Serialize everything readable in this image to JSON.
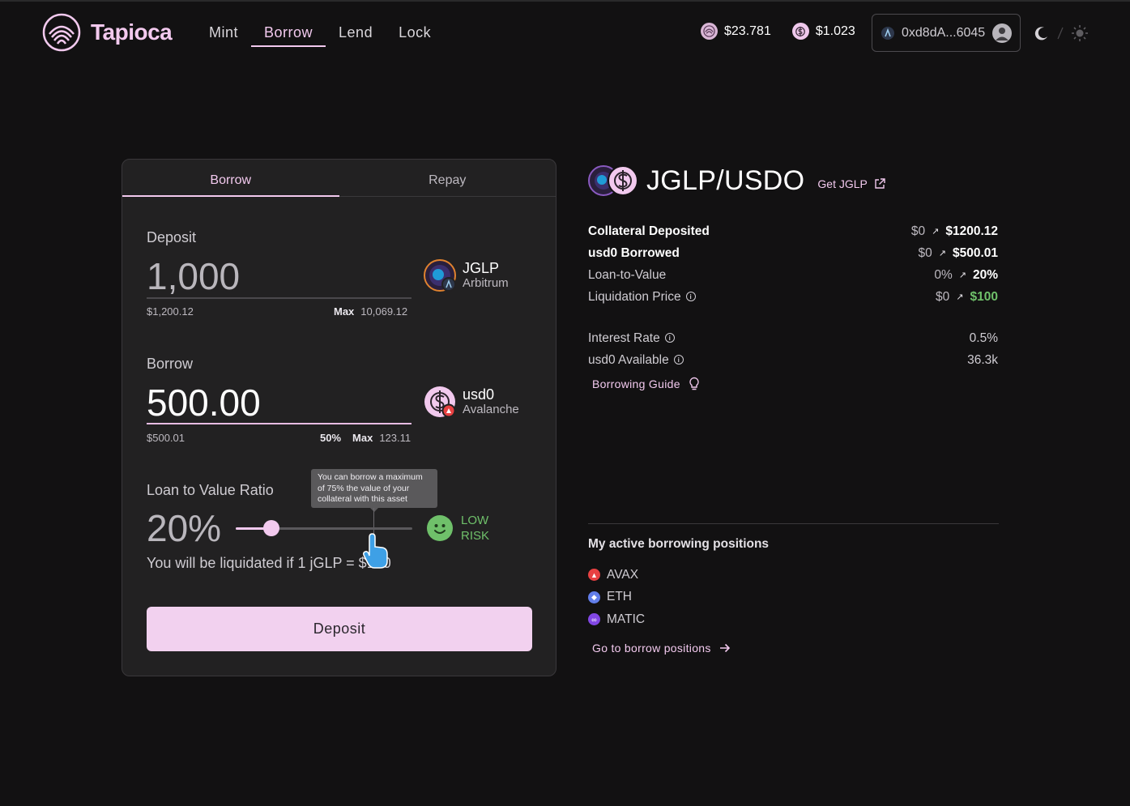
{
  "app": {
    "name": "Tapioca"
  },
  "nav": {
    "items": [
      "Mint",
      "Borrow",
      "Lend",
      "Lock"
    ],
    "active": "Borrow"
  },
  "header": {
    "prices": [
      {
        "icon": "tap-coin-icon",
        "value": "$23.781"
      },
      {
        "icon": "usdo-coin-icon",
        "value": "$1.023"
      }
    ],
    "wallet": {
      "address": "0xd8dA...6045"
    }
  },
  "card": {
    "tabs": [
      "Borrow",
      "Repay"
    ],
    "active_tab": "Borrow",
    "deposit": {
      "label": "Deposit",
      "value": "1,000",
      "usd": "$1,200.12",
      "max_label": "Max",
      "max_value": "10,069.12",
      "asset": "JGLP",
      "chain": "Arbitrum"
    },
    "borrow": {
      "label": "Borrow",
      "value": "500.00",
      "usd": "$500.01",
      "pct": "50%",
      "max_label": "Max",
      "max_value": "123.11",
      "asset": "usd0",
      "chain": "Avalanche"
    },
    "ltv": {
      "label": "Loan to Value Ratio",
      "value": "20%",
      "slider_level": 0.2,
      "max_level": 0.75,
      "tooltip": "You can borrow a maximum of 75% the value of your collateral with this asset",
      "risk_line1": "LOW",
      "risk_line2": "RISK",
      "liquidation_text": "You will be liquidated if  1 jGLP = $100"
    },
    "submit_label": "Deposit"
  },
  "panel": {
    "pair": "JGLP/USDO",
    "get_link": "Get JGLP",
    "stats": [
      {
        "label": "Collateral Deposited",
        "from": "$0",
        "to": "$1200.12",
        "strong": true
      },
      {
        "label": "usd0 Borrowed",
        "from": "$0",
        "to": "$500.01",
        "strong": true
      },
      {
        "label": "Loan-to-Value",
        "from": "0%",
        "to": "20%"
      },
      {
        "label": "Liquidation Price",
        "from": "$0",
        "to": "$100",
        "info": true,
        "green": true
      }
    ],
    "rates": [
      {
        "label": "Interest Rate",
        "value": "0.5%"
      },
      {
        "label": "usd0 Available",
        "value": "36.3k"
      }
    ],
    "guide_label": "Borrowing Guide",
    "positions_title": "My active borrowing positions",
    "positions": [
      {
        "name": "AVAX",
        "color": "#e84142"
      },
      {
        "name": "ETH",
        "color": "#627eea"
      },
      {
        "name": "MATIC",
        "color": "#8247e5"
      }
    ],
    "goto_label": "Go to borrow positions"
  },
  "colors": {
    "accent": "#f2c9ee",
    "success": "#6fc06a",
    "background": "#121112",
    "card": "#222122"
  }
}
